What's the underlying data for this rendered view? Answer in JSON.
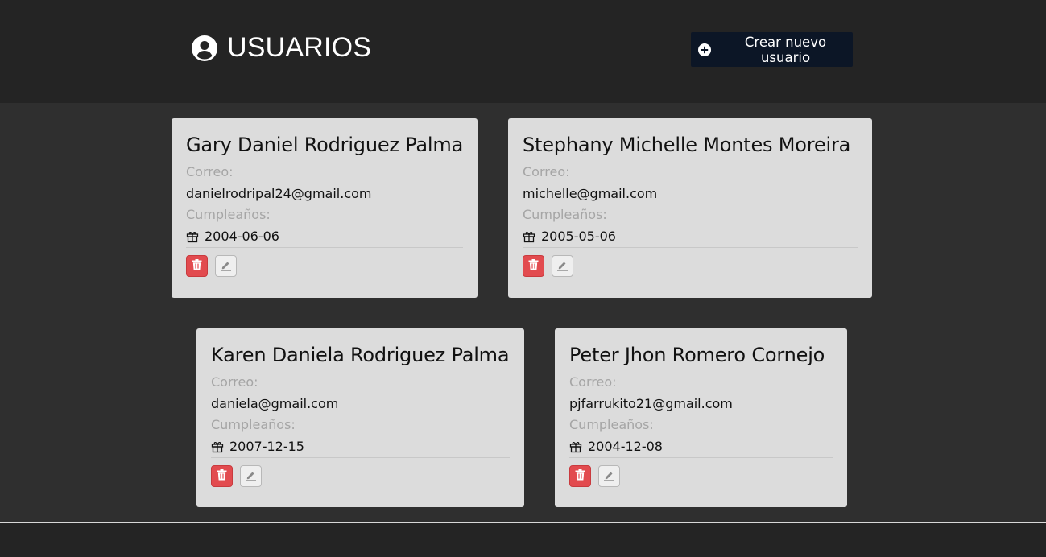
{
  "header": {
    "title": "USUARIOS",
    "title_icon": "user-circle-icon",
    "create_button_label": "Crear nuevo usuario",
    "create_button_icon": "plus-circle-icon"
  },
  "labels": {
    "email": "Correo:",
    "birthday": "Cumpleaños:"
  },
  "users": [
    {
      "name": "Gary Daniel Rodriguez Palma",
      "email": "danielrodripal24@gmail.com",
      "birthday": "2004-06-06"
    },
    {
      "name": "Stephany Michelle Montes Moreira",
      "email": "michelle@gmail.com",
      "birthday": "2005-05-06"
    },
    {
      "name": "Karen Daniela Rodriguez Palma",
      "email": "daniela@gmail.com",
      "birthday": "2007-12-15"
    },
    {
      "name": "Peter Jhon Romero Cornejo",
      "email": "pjfarrukito21@gmail.com",
      "birthday": "2004-12-08"
    }
  ],
  "colors": {
    "header_bg": "#242424",
    "page_bg": "#2f2f2f",
    "card_bg": "#dcdcdc",
    "create_button_bg": "#0c1626",
    "delete_button_bg": "#e24b4f"
  }
}
